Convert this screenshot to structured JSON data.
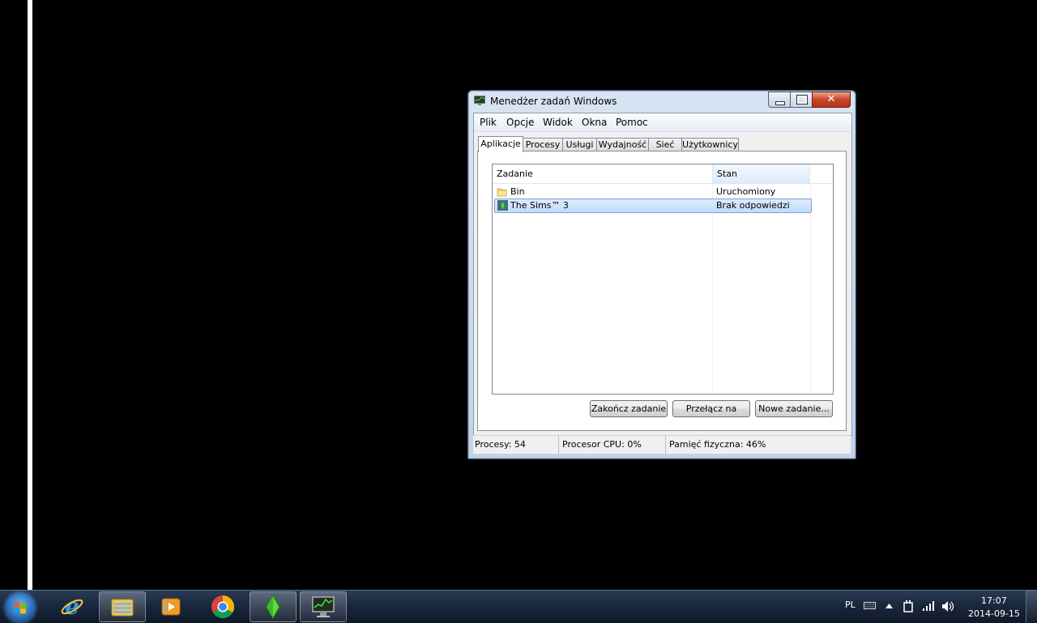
{
  "window": {
    "title": "Menedżer zadań Windows",
    "close_glyph": "✕"
  },
  "menu": [
    "Plik",
    "Opcje",
    "Widok",
    "Okna",
    "Pomoc"
  ],
  "tabs": [
    "Aplikacje",
    "Procesy",
    "Usługi",
    "Wydajność",
    "Sieć",
    "Użytkownicy"
  ],
  "active_tab": "Aplikacje",
  "list": {
    "columns": [
      "Zadanie",
      "Stan"
    ],
    "sort_glyph": "ˆ",
    "rows": [
      {
        "name": "Bin",
        "state": "Uruchomiony",
        "icon": "folder-icon",
        "selected": false
      },
      {
        "name": "The Sims™ 3",
        "state": "Brak odpowiedzi",
        "icon": "sims-icon",
        "selected": true
      }
    ]
  },
  "buttons": {
    "end_task": "Zakończ zadanie",
    "switch_to": "Przełącz na",
    "new_task": "Nowe zadanie..."
  },
  "status": {
    "processes": "Procesy: 54",
    "cpu": "Procesor CPU: 0%",
    "memory": "Pamięć fizyczna: 46%"
  },
  "taskbar": {
    "apps": [
      "internet-explorer-icon",
      "file-explorer-icon",
      "media-player-icon",
      "chrome-icon",
      "sims-icon",
      "task-manager-icon"
    ],
    "lang": "PL",
    "time": "17:07",
    "date": "2014-09-15"
  },
  "colors": {
    "selection": "#cce4fc",
    "taskbar": "#1b2a40",
    "close_button": "#c9442c"
  }
}
